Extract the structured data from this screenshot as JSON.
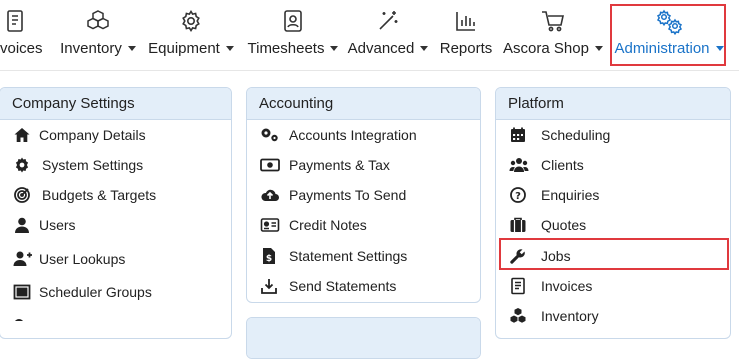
{
  "nav": {
    "items": [
      {
        "label": "Invoices",
        "icon": "invoice-icon",
        "dropdown": false
      },
      {
        "label": "Inventory",
        "icon": "boxes-icon",
        "dropdown": true
      },
      {
        "label": "Equipment",
        "icon": "gear-icon",
        "dropdown": true
      },
      {
        "label": "Timesheets",
        "icon": "badge-icon",
        "dropdown": true
      },
      {
        "label": "Advanced",
        "icon": "magic-wand-icon",
        "dropdown": true
      },
      {
        "label": "Reports",
        "icon": "bar-chart-icon",
        "dropdown": false
      },
      {
        "label": "Ascora Shop",
        "icon": "cart-icon",
        "dropdown": true
      },
      {
        "label": "Administration",
        "icon": "gears-icon",
        "dropdown": true,
        "active": true
      }
    ]
  },
  "menu": {
    "company_settings": {
      "title": "Company Settings",
      "items": [
        {
          "label": "Company Details",
          "icon": "home-icon"
        },
        {
          "label": "System Settings",
          "icon": "gear-icon"
        },
        {
          "label": "Budgets & Targets",
          "icon": "target-icon"
        },
        {
          "label": "Users",
          "icon": "user-icon"
        },
        {
          "label": "User Lookups",
          "icon": "user-plus-icon"
        },
        {
          "label": "Scheduler Groups",
          "icon": "group-board-icon"
        }
      ]
    },
    "accounting": {
      "title": "Accounting",
      "items": [
        {
          "label": "Accounts Integration",
          "icon": "cogs-icon"
        },
        {
          "label": "Payments & Tax",
          "icon": "money-icon"
        },
        {
          "label": "Payments To Send",
          "icon": "cloud-upload-icon"
        },
        {
          "label": "Credit Notes",
          "icon": "id-card-icon"
        },
        {
          "label": "Statement Settings",
          "icon": "file-dollar-icon"
        },
        {
          "label": "Send Statements",
          "icon": "inbox-download-icon"
        }
      ]
    },
    "platform": {
      "title": "Platform",
      "items": [
        {
          "label": "Scheduling",
          "icon": "calendar-icon"
        },
        {
          "label": "Clients",
          "icon": "users-icon"
        },
        {
          "label": "Enquiries",
          "icon": "question-circle-icon"
        },
        {
          "label": "Quotes",
          "icon": "briefcase-icon"
        },
        {
          "label": "Jobs",
          "icon": "wrench-icon"
        },
        {
          "label": "Invoices",
          "icon": "invoice-icon"
        },
        {
          "label": "Inventory",
          "icon": "boxes-icon"
        }
      ]
    }
  },
  "colors": {
    "accent": "#1a73c8",
    "highlight": "#e0393e",
    "panel_header": "#e3eef9"
  }
}
